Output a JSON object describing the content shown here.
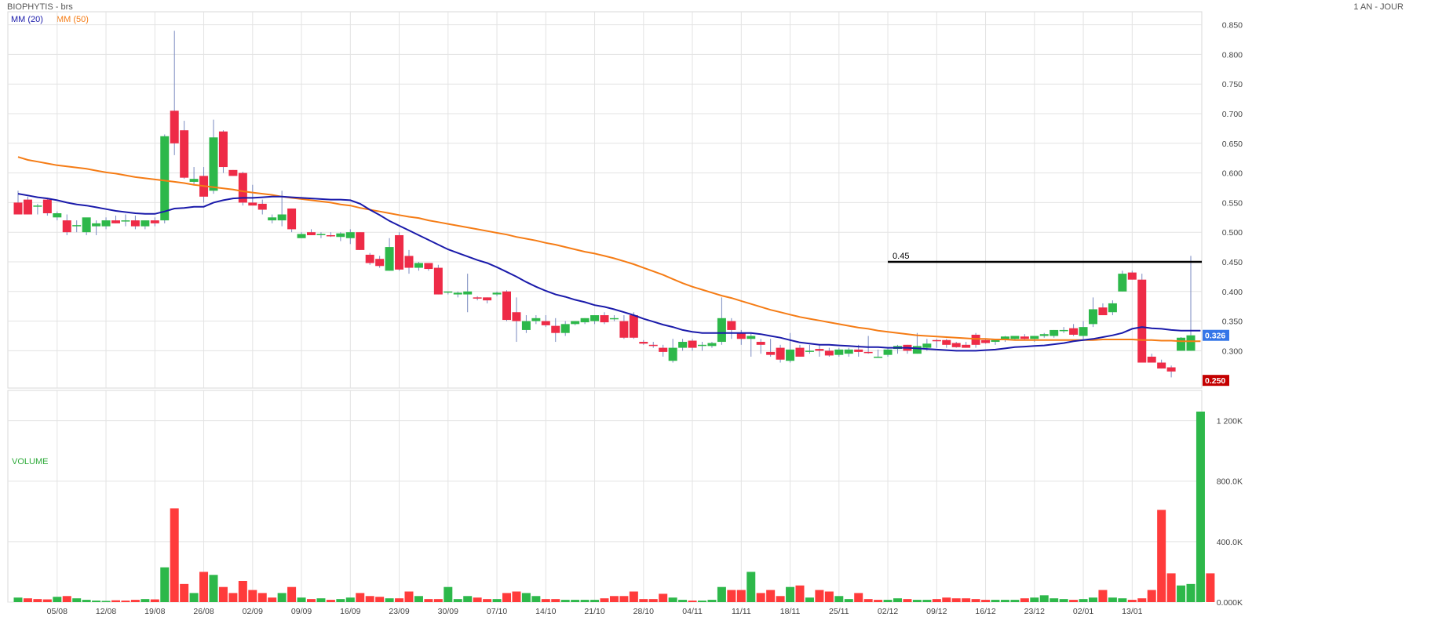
{
  "header": {
    "title": "BIOPHYTIS - brs",
    "period": "1 AN - JOUR"
  },
  "legend": {
    "ma20_label": "MM (20)",
    "ma50_label": "MM (50)"
  },
  "volume_panel": {
    "label": "VOLUME"
  },
  "colors": {
    "up": "#2db84a",
    "down": "#ee2b47",
    "ma20": "#1a1aaa",
    "ma50": "#f57c15",
    "grid": "#e3e3e3",
    "last_badge": "#3576e8",
    "low_badge": "#c40000"
  },
  "chart_data": [
    {
      "type": "candlestick",
      "title": "BIOPHYTIS - brs",
      "price_axis": {
        "ylim": [
          0.237,
          0.872
        ],
        "ticks": [
          "0.300",
          "0.350",
          "0.400",
          "0.450",
          "0.500",
          "0.550",
          "0.600",
          "0.650",
          "0.700",
          "0.750",
          "0.800",
          "0.850"
        ],
        "position": "right"
      },
      "x_ticks": [
        "05/08",
        "12/08",
        "19/08",
        "26/08",
        "02/09",
        "09/09",
        "16/09",
        "23/09",
        "30/09",
        "07/10",
        "14/10",
        "21/10",
        "28/10",
        "04/11",
        "11/11",
        "18/11",
        "25/11",
        "02/12",
        "09/12",
        "16/12",
        "23/12",
        "02/01",
        "13/01"
      ],
      "tick_index": [
        4,
        9,
        14,
        19,
        24,
        29,
        34,
        39,
        44,
        49,
        54,
        59,
        64,
        69,
        74,
        79,
        84,
        89,
        94,
        99,
        104,
        109,
        114
      ],
      "ohlc": [
        [
          0.55,
          0.57,
          0.53,
          0.53
        ],
        [
          0.555,
          0.56,
          0.53,
          0.53
        ],
        [
          0.545,
          0.548,
          0.53,
          0.545
        ],
        [
          0.555,
          0.558,
          0.528,
          0.532
        ],
        [
          0.525,
          0.535,
          0.52,
          0.532
        ],
        [
          0.52,
          0.53,
          0.495,
          0.5
        ],
        [
          0.51,
          0.52,
          0.5,
          0.512
        ],
        [
          0.5,
          0.52,
          0.495,
          0.525
        ],
        [
          0.51,
          0.52,
          0.495,
          0.515
        ],
        [
          0.51,
          0.525,
          0.505,
          0.52
        ],
        [
          0.52,
          0.528,
          0.515,
          0.515
        ],
        [
          0.52,
          0.53,
          0.51,
          0.52
        ],
        [
          0.52,
          0.528,
          0.505,
          0.51
        ],
        [
          0.51,
          0.52,
          0.505,
          0.52
        ],
        [
          0.52,
          0.525,
          0.51,
          0.515
        ],
        [
          0.52,
          0.665,
          0.515,
          0.662
        ],
        [
          0.705,
          0.84,
          0.63,
          0.65
        ],
        [
          0.672,
          0.688,
          0.59,
          0.592
        ],
        [
          0.585,
          0.61,
          0.58,
          0.59
        ],
        [
          0.595,
          0.61,
          0.55,
          0.56
        ],
        [
          0.57,
          0.69,
          0.565,
          0.66
        ],
        [
          0.67,
          0.672,
          0.6,
          0.61
        ],
        [
          0.605,
          0.605,
          0.595,
          0.595
        ],
        [
          0.6,
          0.602,
          0.545,
          0.55
        ],
        [
          0.55,
          0.58,
          0.545,
          0.545
        ],
        [
          0.548,
          0.555,
          0.53,
          0.538
        ],
        [
          0.52,
          0.53,
          0.515,
          0.525
        ],
        [
          0.52,
          0.57,
          0.51,
          0.53
        ],
        [
          0.54,
          0.54,
          0.5,
          0.505
        ],
        [
          0.49,
          0.5,
          0.49,
          0.497
        ],
        [
          0.5,
          0.505,
          0.495,
          0.495
        ],
        [
          0.495,
          0.5,
          0.49,
          0.497
        ],
        [
          0.495,
          0.5,
          0.492,
          0.493
        ],
        [
          0.492,
          0.5,
          0.485,
          0.498
        ],
        [
          0.49,
          0.505,
          0.48,
          0.5
        ],
        [
          0.5,
          0.5,
          0.47,
          0.47
        ],
        [
          0.462,
          0.465,
          0.445,
          0.448
        ],
        [
          0.455,
          0.46,
          0.44,
          0.443
        ],
        [
          0.435,
          0.49,
          0.435,
          0.475
        ],
        [
          0.495,
          0.5,
          0.435,
          0.437
        ],
        [
          0.46,
          0.47,
          0.43,
          0.44
        ],
        [
          0.44,
          0.45,
          0.435,
          0.448
        ],
        [
          0.448,
          0.448,
          0.435,
          0.438
        ],
        [
          0.44,
          0.445,
          0.395,
          0.395
        ],
        [
          0.4,
          0.4,
          0.395,
          0.4
        ],
        [
          0.395,
          0.4,
          0.39,
          0.398
        ],
        [
          0.395,
          0.43,
          0.365,
          0.4
        ],
        [
          0.39,
          0.392,
          0.385,
          0.388
        ],
        [
          0.39,
          0.39,
          0.38,
          0.385
        ],
        [
          0.395,
          0.4,
          0.392,
          0.398
        ],
        [
          0.4,
          0.402,
          0.35,
          0.352
        ],
        [
          0.365,
          0.39,
          0.315,
          0.35
        ],
        [
          0.335,
          0.36,
          0.33,
          0.35
        ],
        [
          0.35,
          0.36,
          0.345,
          0.355
        ],
        [
          0.35,
          0.36,
          0.34,
          0.343
        ],
        [
          0.342,
          0.355,
          0.315,
          0.33
        ],
        [
          0.33,
          0.35,
          0.325,
          0.345
        ],
        [
          0.345,
          0.35,
          0.343,
          0.35
        ],
        [
          0.348,
          0.355,
          0.345,
          0.355
        ],
        [
          0.35,
          0.36,
          0.345,
          0.36
        ],
        [
          0.36,
          0.365,
          0.345,
          0.348
        ],
        [
          0.355,
          0.36,
          0.35,
          0.355
        ],
        [
          0.35,
          0.36,
          0.32,
          0.322
        ],
        [
          0.36,
          0.365,
          0.32,
          0.322
        ],
        [
          0.315,
          0.318,
          0.31,
          0.312
        ],
        [
          0.31,
          0.315,
          0.305,
          0.308
        ],
        [
          0.305,
          0.31,
          0.29,
          0.298
        ],
        [
          0.283,
          0.32,
          0.28,
          0.305
        ],
        [
          0.305,
          0.32,
          0.3,
          0.315
        ],
        [
          0.317,
          0.32,
          0.3,
          0.305
        ],
        [
          0.31,
          0.315,
          0.3,
          0.31
        ],
        [
          0.308,
          0.315,
          0.305,
          0.313
        ],
        [
          0.315,
          0.39,
          0.31,
          0.355
        ],
        [
          0.35,
          0.355,
          0.32,
          0.335
        ],
        [
          0.33,
          0.335,
          0.31,
          0.32
        ],
        [
          0.32,
          0.33,
          0.29,
          0.325
        ],
        [
          0.315,
          0.32,
          0.295,
          0.31
        ],
        [
          0.298,
          0.32,
          0.29,
          0.293
        ],
        [
          0.305,
          0.31,
          0.28,
          0.285
        ],
        [
          0.283,
          0.33,
          0.28,
          0.302
        ],
        [
          0.305,
          0.31,
          0.29,
          0.29
        ],
        [
          0.3,
          0.31,
          0.295,
          0.3
        ],
        [
          0.303,
          0.31,
          0.29,
          0.3
        ],
        [
          0.3,
          0.305,
          0.29,
          0.292
        ],
        [
          0.293,
          0.305,
          0.29,
          0.302
        ],
        [
          0.295,
          0.305,
          0.29,
          0.302
        ],
        [
          0.302,
          0.31,
          0.29,
          0.298
        ],
        [
          0.298,
          0.325,
          0.295,
          0.296
        ],
        [
          0.29,
          0.302,
          0.288,
          0.29
        ],
        [
          0.293,
          0.305,
          0.29,
          0.302
        ],
        [
          0.303,
          0.31,
          0.295,
          0.308
        ],
        [
          0.31,
          0.31,
          0.295,
          0.3
        ],
        [
          0.295,
          0.33,
          0.295,
          0.308
        ],
        [
          0.305,
          0.32,
          0.3,
          0.312
        ],
        [
          0.318,
          0.32,
          0.305,
          0.317
        ],
        [
          0.318,
          0.32,
          0.305,
          0.31
        ],
        [
          0.313,
          0.315,
          0.305,
          0.306
        ],
        [
          0.31,
          0.315,
          0.305,
          0.305
        ],
        [
          0.327,
          0.33,
          0.305,
          0.31
        ],
        [
          0.318,
          0.32,
          0.312,
          0.313
        ],
        [
          0.315,
          0.32,
          0.31,
          0.318
        ],
        [
          0.318,
          0.325,
          0.315,
          0.324
        ],
        [
          0.32,
          0.322,
          0.318,
          0.325
        ],
        [
          0.324,
          0.328,
          0.318,
          0.32
        ],
        [
          0.32,
          0.325,
          0.315,
          0.325
        ],
        [
          0.325,
          0.33,
          0.322,
          0.328
        ],
        [
          0.325,
          0.335,
          0.322,
          0.335
        ],
        [
          0.335,
          0.34,
          0.33,
          0.335
        ],
        [
          0.338,
          0.345,
          0.325,
          0.327
        ],
        [
          0.325,
          0.35,
          0.32,
          0.34
        ],
        [
          0.345,
          0.39,
          0.34,
          0.37
        ],
        [
          0.373,
          0.38,
          0.36,
          0.36
        ],
        [
          0.365,
          0.385,
          0.36,
          0.38
        ],
        [
          0.4,
          0.435,
          0.4,
          0.43
        ],
        [
          0.432,
          0.435,
          0.42,
          0.42
        ],
        [
          0.42,
          0.43,
          0.28,
          0.28
        ],
        [
          0.29,
          0.295,
          0.28,
          0.28
        ],
        [
          0.28,
          0.285,
          0.27,
          0.27
        ],
        [
          0.272,
          0.275,
          0.255,
          0.265
        ],
        [
          0.3,
          0.323,
          0.3,
          0.322
        ],
        [
          0.3,
          0.46,
          0.3,
          0.326
        ]
      ],
      "ma20": [
        0.565,
        0.562,
        0.559,
        0.557,
        0.554,
        0.55,
        0.547,
        0.545,
        0.542,
        0.539,
        0.536,
        0.534,
        0.532,
        0.531,
        0.531,
        0.535,
        0.54,
        0.541,
        0.543,
        0.543,
        0.55,
        0.554,
        0.557,
        0.558,
        0.558,
        0.559,
        0.56,
        0.56,
        0.559,
        0.558,
        0.557,
        0.556,
        0.555,
        0.555,
        0.554,
        0.548,
        0.538,
        0.529,
        0.519,
        0.511,
        0.503,
        0.495,
        0.487,
        0.479,
        0.471,
        0.465,
        0.459,
        0.453,
        0.448,
        0.441,
        0.433,
        0.425,
        0.416,
        0.408,
        0.401,
        0.395,
        0.391,
        0.386,
        0.382,
        0.377,
        0.374,
        0.37,
        0.365,
        0.36,
        0.354,
        0.349,
        0.344,
        0.34,
        0.335,
        0.332,
        0.33,
        0.33,
        0.33,
        0.33,
        0.33,
        0.33,
        0.328,
        0.325,
        0.322,
        0.318,
        0.314,
        0.312,
        0.31,
        0.31,
        0.309,
        0.308,
        0.307,
        0.306,
        0.306,
        0.305,
        0.305,
        0.305,
        0.304,
        0.303,
        0.302,
        0.301,
        0.3,
        0.3,
        0.3,
        0.301,
        0.302,
        0.304,
        0.306,
        0.307,
        0.308,
        0.309,
        0.311,
        0.313,
        0.316,
        0.318,
        0.32,
        0.323,
        0.326,
        0.33,
        0.337,
        0.34,
        0.338,
        0.337,
        0.335,
        0.334,
        0.334,
        0.334
      ],
      "ma50": [
        0.627,
        0.622,
        0.619,
        0.616,
        0.613,
        0.611,
        0.609,
        0.607,
        0.604,
        0.601,
        0.599,
        0.596,
        0.593,
        0.591,
        0.589,
        0.587,
        0.585,
        0.583,
        0.58,
        0.578,
        0.576,
        0.574,
        0.572,
        0.569,
        0.567,
        0.565,
        0.563,
        0.56,
        0.558,
        0.556,
        0.554,
        0.552,
        0.55,
        0.547,
        0.545,
        0.541,
        0.538,
        0.535,
        0.532,
        0.529,
        0.526,
        0.524,
        0.52,
        0.517,
        0.514,
        0.511,
        0.508,
        0.505,
        0.502,
        0.499,
        0.496,
        0.492,
        0.489,
        0.486,
        0.482,
        0.479,
        0.475,
        0.471,
        0.467,
        0.464,
        0.46,
        0.456,
        0.451,
        0.446,
        0.44,
        0.434,
        0.428,
        0.421,
        0.414,
        0.408,
        0.403,
        0.398,
        0.393,
        0.389,
        0.384,
        0.379,
        0.374,
        0.369,
        0.365,
        0.361,
        0.357,
        0.354,
        0.351,
        0.348,
        0.345,
        0.342,
        0.339,
        0.337,
        0.334,
        0.332,
        0.33,
        0.328,
        0.326,
        0.325,
        0.324,
        0.323,
        0.322,
        0.321,
        0.32,
        0.32,
        0.319,
        0.319,
        0.318,
        0.318,
        0.318,
        0.318,
        0.318,
        0.318,
        0.318,
        0.318,
        0.318,
        0.319,
        0.319,
        0.319,
        0.319,
        0.318,
        0.318,
        0.317,
        0.317,
        0.316,
        0.316,
        0.316
      ],
      "annotations": [
        {
          "label": "0.45",
          "value": 0.45
        }
      ],
      "last_price": "0.326",
      "low_price": "0.250",
      "legend": [
        "MM (20)",
        "MM (50)"
      ]
    },
    {
      "type": "bar",
      "title": "VOLUME",
      "volume_axis": {
        "ylim": [
          0,
          1400000
        ],
        "ticks": [
          "0.000K",
          "400.0K",
          "800.0K",
          "1 200K"
        ],
        "tick_values": [
          0,
          400000,
          800000,
          1200000
        ],
        "position": "right"
      },
      "values": [
        30000,
        25000,
        20000,
        18000,
        35000,
        40000,
        25000,
        15000,
        10000,
        8000,
        12000,
        10000,
        15000,
        20000,
        18000,
        230000,
        620000,
        120000,
        60000,
        200000,
        180000,
        100000,
        60000,
        140000,
        80000,
        60000,
        30000,
        60000,
        100000,
        30000,
        20000,
        25000,
        15000,
        20000,
        30000,
        60000,
        40000,
        35000,
        25000,
        25000,
        70000,
        40000,
        20000,
        20000,
        100000,
        20000,
        40000,
        30000,
        20000,
        20000,
        60000,
        70000,
        60000,
        40000,
        20000,
        20000,
        15000,
        15000,
        15000,
        15000,
        25000,
        40000,
        40000,
        70000,
        20000,
        20000,
        55000,
        30000,
        15000,
        10000,
        10000,
        15000,
        100000,
        80000,
        80000,
        200000,
        60000,
        80000,
        40000,
        100000,
        110000,
        30000,
        80000,
        70000,
        40000,
        20000,
        60000,
        20000,
        15000,
        15000,
        25000,
        20000,
        15000,
        15000,
        20000,
        30000,
        25000,
        25000,
        20000,
        15000,
        15000,
        15000,
        15000,
        25000,
        30000,
        45000,
        25000,
        20000,
        15000,
        20000,
        30000,
        80000,
        30000,
        25000,
        15000,
        25000,
        80000,
        610000,
        190000,
        110000,
        120000,
        1260000,
        190000
      ],
      "up": [
        true,
        false,
        false,
        false,
        true,
        false,
        true,
        true,
        true,
        true,
        false,
        false,
        false,
        true,
        false,
        true,
        false,
        false,
        true,
        false,
        true,
        false,
        false,
        false,
        false,
        false,
        false,
        true,
        false,
        true,
        false,
        true,
        false,
        true,
        true,
        false,
        false,
        false,
        true,
        false,
        false,
        true,
        false,
        false,
        true,
        true,
        true,
        false,
        false,
        true,
        false,
        false,
        true,
        true,
        false,
        false,
        true,
        true,
        true,
        true,
        false,
        false,
        false,
        false,
        false,
        false,
        false,
        true,
        true,
        false,
        true,
        true,
        true,
        false,
        false,
        true,
        false,
        false,
        false,
        true,
        false,
        true,
        false,
        false,
        true,
        true,
        false,
        false,
        false,
        true,
        true,
        false,
        true,
        true,
        false,
        false,
        false,
        false,
        false,
        false,
        true,
        true,
        true,
        false,
        true,
        true,
        true,
        true,
        false,
        true,
        true,
        false,
        true,
        true,
        false,
        false,
        false,
        false,
        false,
        true,
        true,
        true
      ]
    }
  ]
}
